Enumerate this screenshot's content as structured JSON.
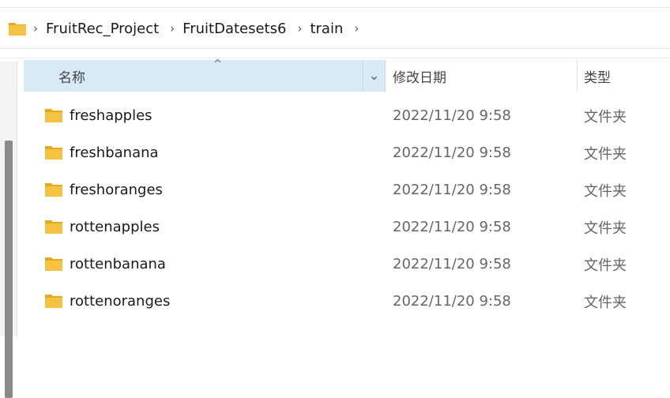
{
  "addressbar": {
    "icon": "folder-icon",
    "crumbs": [
      "FruitRec_Project",
      "FruitDatesets6",
      "train"
    ],
    "separator": "›"
  },
  "columns": {
    "name": "名称",
    "date": "修改日期",
    "type": "类型",
    "sort_indicator": "^",
    "dropdown": "⌄"
  },
  "rows": [
    {
      "name": "freshapples",
      "date": "2022/11/20 9:58",
      "type": "文件夹"
    },
    {
      "name": "freshbanana",
      "date": "2022/11/20 9:58",
      "type": "文件夹"
    },
    {
      "name": "freshoranges",
      "date": "2022/11/20 9:58",
      "type": "文件夹"
    },
    {
      "name": "rottenapples",
      "date": "2022/11/20 9:58",
      "type": "文件夹"
    },
    {
      "name": "rottenbanana",
      "date": "2022/11/20 9:58",
      "type": "文件夹"
    },
    {
      "name": "rottenoranges",
      "date": "2022/11/20 9:58",
      "type": "文件夹"
    }
  ],
  "colors": {
    "folder": "#f5c242",
    "folder_dark": "#e7a91c",
    "header_selected": "#d9eaf7"
  }
}
